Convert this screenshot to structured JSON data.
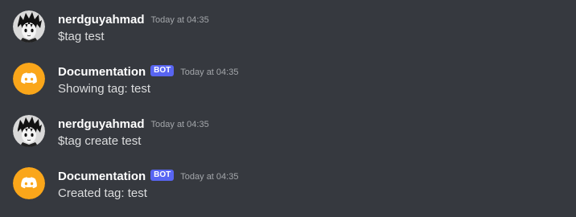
{
  "messages": [
    {
      "author": "nerdguyahmad",
      "avatar_icon": "anime-character-avatar",
      "bot_tag": "",
      "timestamp": "Today at 04:35",
      "content": "$tag test"
    },
    {
      "author": "Documentation",
      "avatar_icon": "discord-logo-avatar",
      "bot_tag": "BOT",
      "timestamp": "Today at 04:35",
      "content": "Showing tag: test"
    },
    {
      "author": "nerdguyahmad",
      "avatar_icon": "anime-character-avatar",
      "bot_tag": "",
      "timestamp": "Today at 04:35",
      "content": "$tag create test"
    },
    {
      "author": "Documentation",
      "avatar_icon": "discord-logo-avatar",
      "bot_tag": "BOT",
      "timestamp": "Today at 04:35",
      "content": "Created tag: test"
    }
  ],
  "colors": {
    "background": "#36393f",
    "username": "#ffffff",
    "message_text": "#dcddde",
    "timestamp": "#a3a6aa",
    "bot_tag_bg": "#5865f2",
    "bot_avatar_bg": "#faa61a"
  }
}
